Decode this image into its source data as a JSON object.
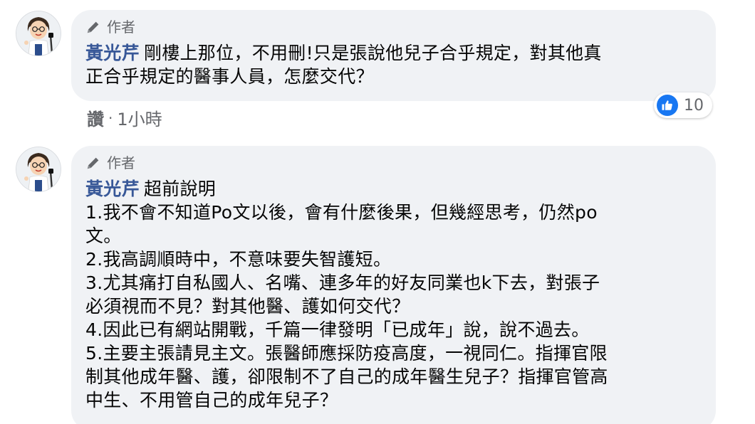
{
  "comments": [
    {
      "badge": "作者",
      "author": "黃光芹",
      "lines": [
        "剛樓上那位，不用刪!只是張說他兒子合乎規定，對其他真",
        "正合乎規定的醫事人員，怎麼交代？"
      ],
      "reactions": {
        "icon": "like-icon",
        "count": "10"
      },
      "actions": {
        "like": "讚",
        "separator": "·",
        "time": "1小時"
      }
    },
    {
      "badge": "作者",
      "author": "黃光芹",
      "lines": [
        "超前說明",
        "1.我不會不知道Po文以後，會有什麼後果，但幾經思考，仍然po",
        "文。",
        "2.我高調順時中，不意味要失智護短。",
        "3.尤其痛打自私國人、名嘴、連多年的好友同業也k下去，對張子",
        "必須視而不見？對其他醫、護如何交代？",
        "4.因此已有網站開戰，千篇一律發明「已成年」說，說不過去。",
        "5.主要主張請見主文。張醫師應採防疫高度，一視同仁。指揮官限",
        "制其他成年醫、護，卻限制不了自己的成年醫生兒子？指揮官管高",
        "中生、不用管自己的成年兒子？"
      ]
    }
  ],
  "colors": {
    "bubble": "#f0f2f5",
    "author_name": "#385898",
    "meta": "#65676b",
    "like_blue": "#1877f2"
  }
}
